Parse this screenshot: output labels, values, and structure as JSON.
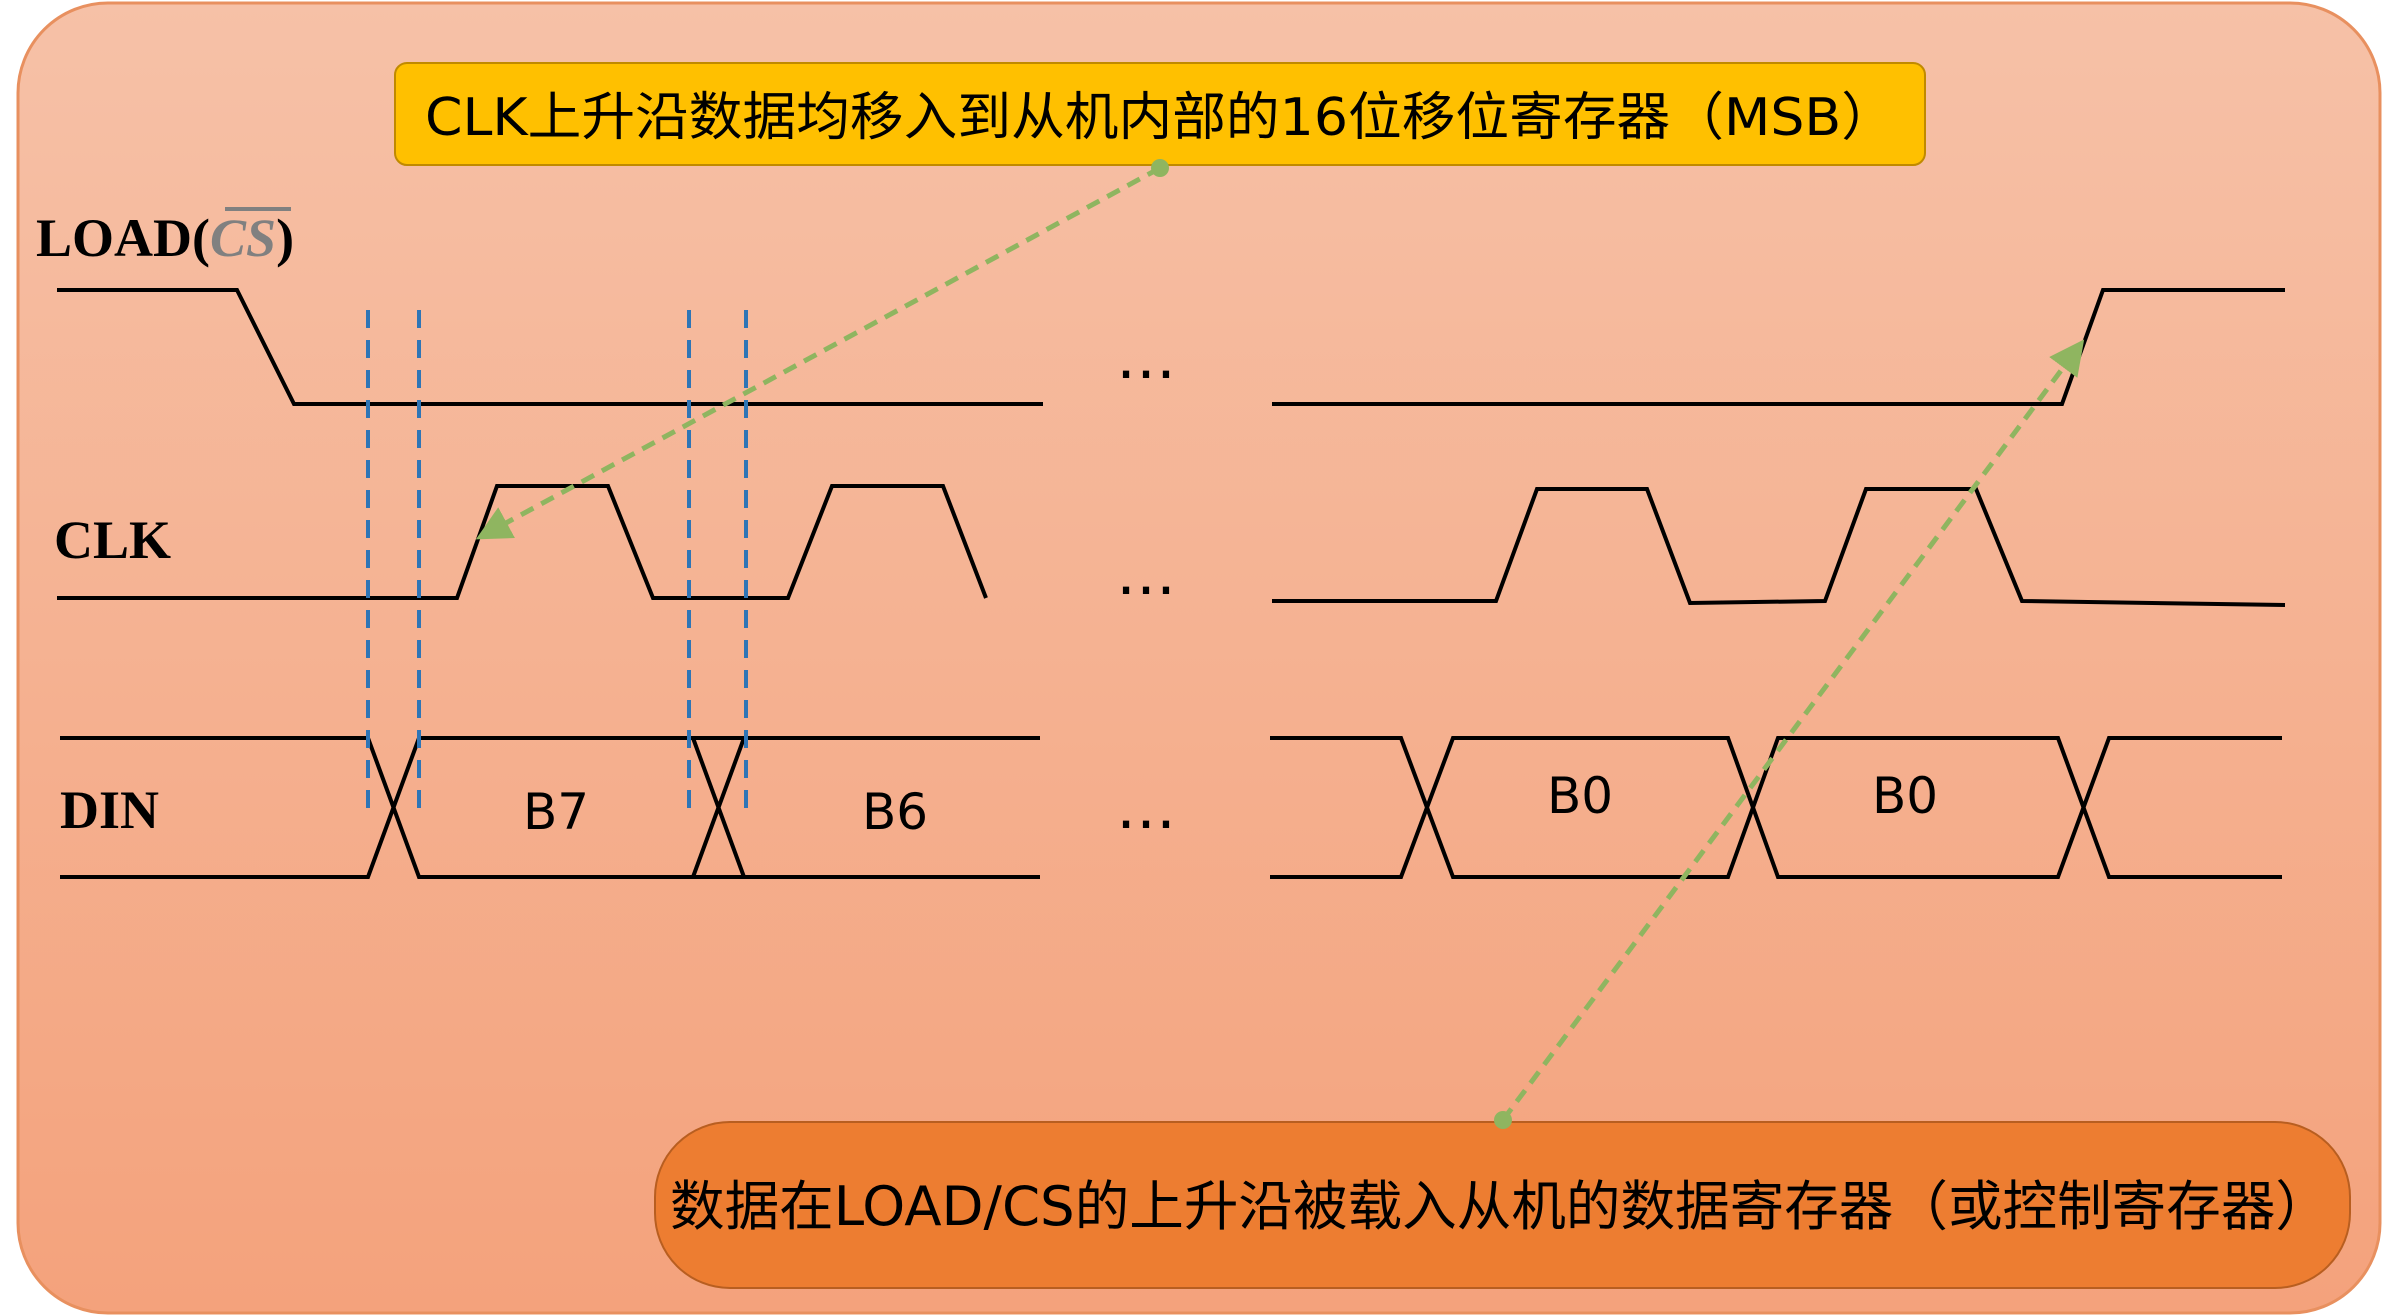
{
  "colors": {
    "panel_top": "#f6c1a7",
    "panel_bottom": "#f4a27c",
    "panel_border": "#e8905f",
    "callout_top_fill": "#ffc000",
    "callout_bottom_fill": "#ed7d31",
    "waveform": "#000000",
    "guide_dashed": "#2e75b6",
    "arrow_dashed": "#8fb560",
    "cs_overbar_text": "#808080"
  },
  "callouts": {
    "top": "CLK上升沿数据均移入到从机内部的16位移位寄存器（MSB）",
    "bottom": "数据在LOAD/CS的上升沿被载入从机的数据寄存器（或控制寄存器）"
  },
  "signals": {
    "load_prefix": "LOAD(",
    "load_cs": "CS",
    "load_suffix": ")",
    "clk": "CLK",
    "din": "DIN"
  },
  "din_cells": [
    "B7",
    "B6",
    "B0",
    "B0"
  ],
  "ellipsis": "…"
}
